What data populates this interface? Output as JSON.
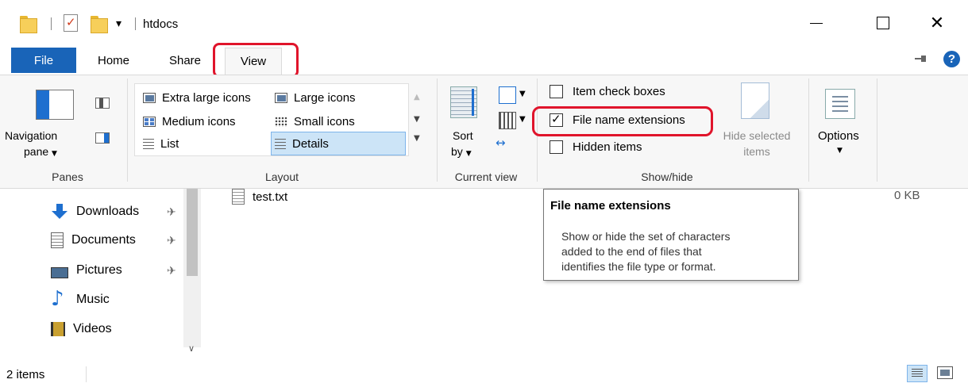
{
  "window": {
    "title": "htdocs"
  },
  "tabs": [
    {
      "label": "File"
    },
    {
      "label": "Home"
    },
    {
      "label": "Share"
    },
    {
      "label": "View"
    }
  ],
  "ribbon": {
    "panes": {
      "nav_pane_label_1": "Navigation",
      "nav_pane_label_2": "pane",
      "group_label": "Panes"
    },
    "layout": {
      "items": [
        {
          "label": "Extra large icons"
        },
        {
          "label": "Large icons"
        },
        {
          "label": "Medium icons"
        },
        {
          "label": "Small icons"
        },
        {
          "label": "List"
        },
        {
          "label": "Details"
        }
      ],
      "selected": "Details",
      "group_label": "Layout"
    },
    "current_view": {
      "sort_label_1": "Sort",
      "sort_label_2": "by",
      "group_label": "Current view"
    },
    "show_hide": {
      "item_check_boxes": {
        "label": "Item check boxes",
        "checked": false
      },
      "file_name_extensions": {
        "label": "File name extensions",
        "checked": true
      },
      "hidden_items": {
        "label": "Hidden items",
        "checked": false
      },
      "hide_selected_1": "Hide selected",
      "hide_selected_2": "items",
      "group_label": "Show/hide"
    },
    "options": {
      "label": "Options"
    }
  },
  "nav": {
    "items": [
      {
        "label": "Downloads",
        "icon": "download-icon",
        "pinned": true
      },
      {
        "label": "Documents",
        "icon": "documents-icon",
        "pinned": true
      },
      {
        "label": "Pictures",
        "icon": "pictures-icon",
        "pinned": true
      },
      {
        "label": "Music",
        "icon": "music-icon",
        "pinned": false
      },
      {
        "label": "Videos",
        "icon": "videos-icon",
        "pinned": false
      }
    ]
  },
  "files": [
    {
      "name": "test.txt",
      "size": "0 KB"
    }
  ],
  "tooltip": {
    "title": "File name extensions",
    "line1": "Show or hide the set of characters",
    "line2": "added to the end of files that",
    "line3": "identifies the file type or format."
  },
  "status": {
    "item_count": "2 items"
  },
  "colors": {
    "accent": "#1964b8",
    "highlight": "#e0142b",
    "selection": "#cce4f7"
  }
}
